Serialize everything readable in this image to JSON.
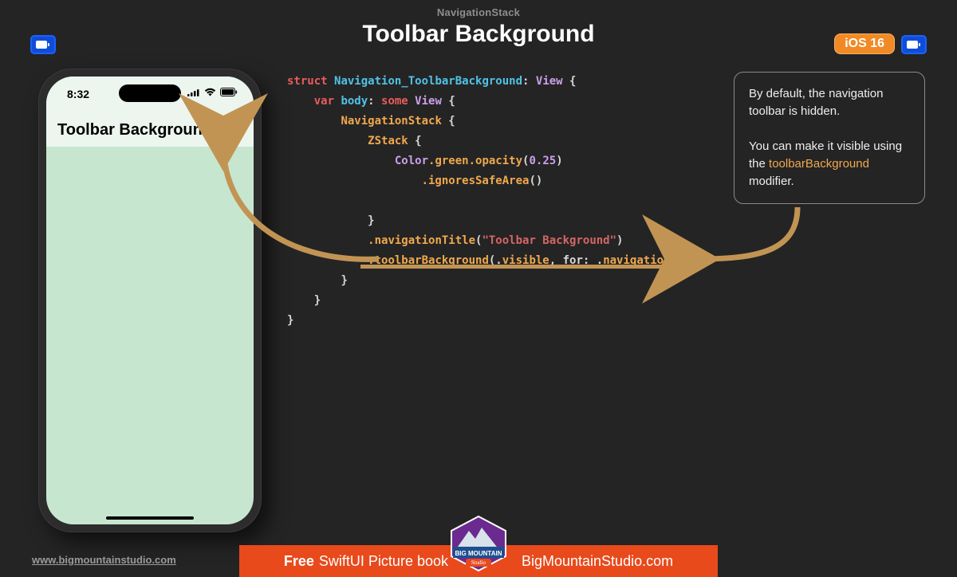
{
  "header": {
    "subtitle": "NavigationStack",
    "title": "Toolbar Background",
    "ios_badge": "iOS 16"
  },
  "phone": {
    "time": "8:32",
    "title": "Toolbar Background"
  },
  "code": {
    "kw_struct": "struct ",
    "typename": "Navigation_ToolbarBackground",
    "colon_view": ": ",
    "view": "View",
    "open": " {",
    "kw_var": "var ",
    "body": "body",
    "colon_some": ": ",
    "some": "some ",
    "view2": "View",
    "open2": " {",
    "navstack": "NavigationStack",
    "open3": " {",
    "zstack": "ZStack",
    "open4": " {",
    "color": "Color",
    "dot_green": ".green",
    "dot_opacity": ".opacity",
    "lp": "(",
    "num": "0.25",
    "rp": ")",
    "ignores": ".ignoresSafeArea",
    "parens": "()",
    "close4": "}",
    "navtitle": ".navigationTitle",
    "lp2": "(",
    "str": "\"Toolbar Background\"",
    "rp2": ")",
    "tbbg": ".toolbarBackground",
    "lp3": "(.",
    "visible": "visible",
    "for": ", for: .",
    "navbar": "navigationBar",
    "rp3": ")",
    "close3": "}",
    "close2": "}",
    "close1": "}"
  },
  "card": {
    "p1": "By default, the navigation toolbar is hidden.",
    "p2a": "You can make it visible using the ",
    "hl": "toolbarBackground",
    "p2b": " modifier."
  },
  "footer": {
    "link": "www.bigmountainstudio.com",
    "promo_bold": "Free",
    "promo_rest": " SwiftUI Picture book",
    "promo_site": "BigMountainStudio.com",
    "badge_top": "BIG MOUNTAIN",
    "badge_bottom": "Studio"
  }
}
